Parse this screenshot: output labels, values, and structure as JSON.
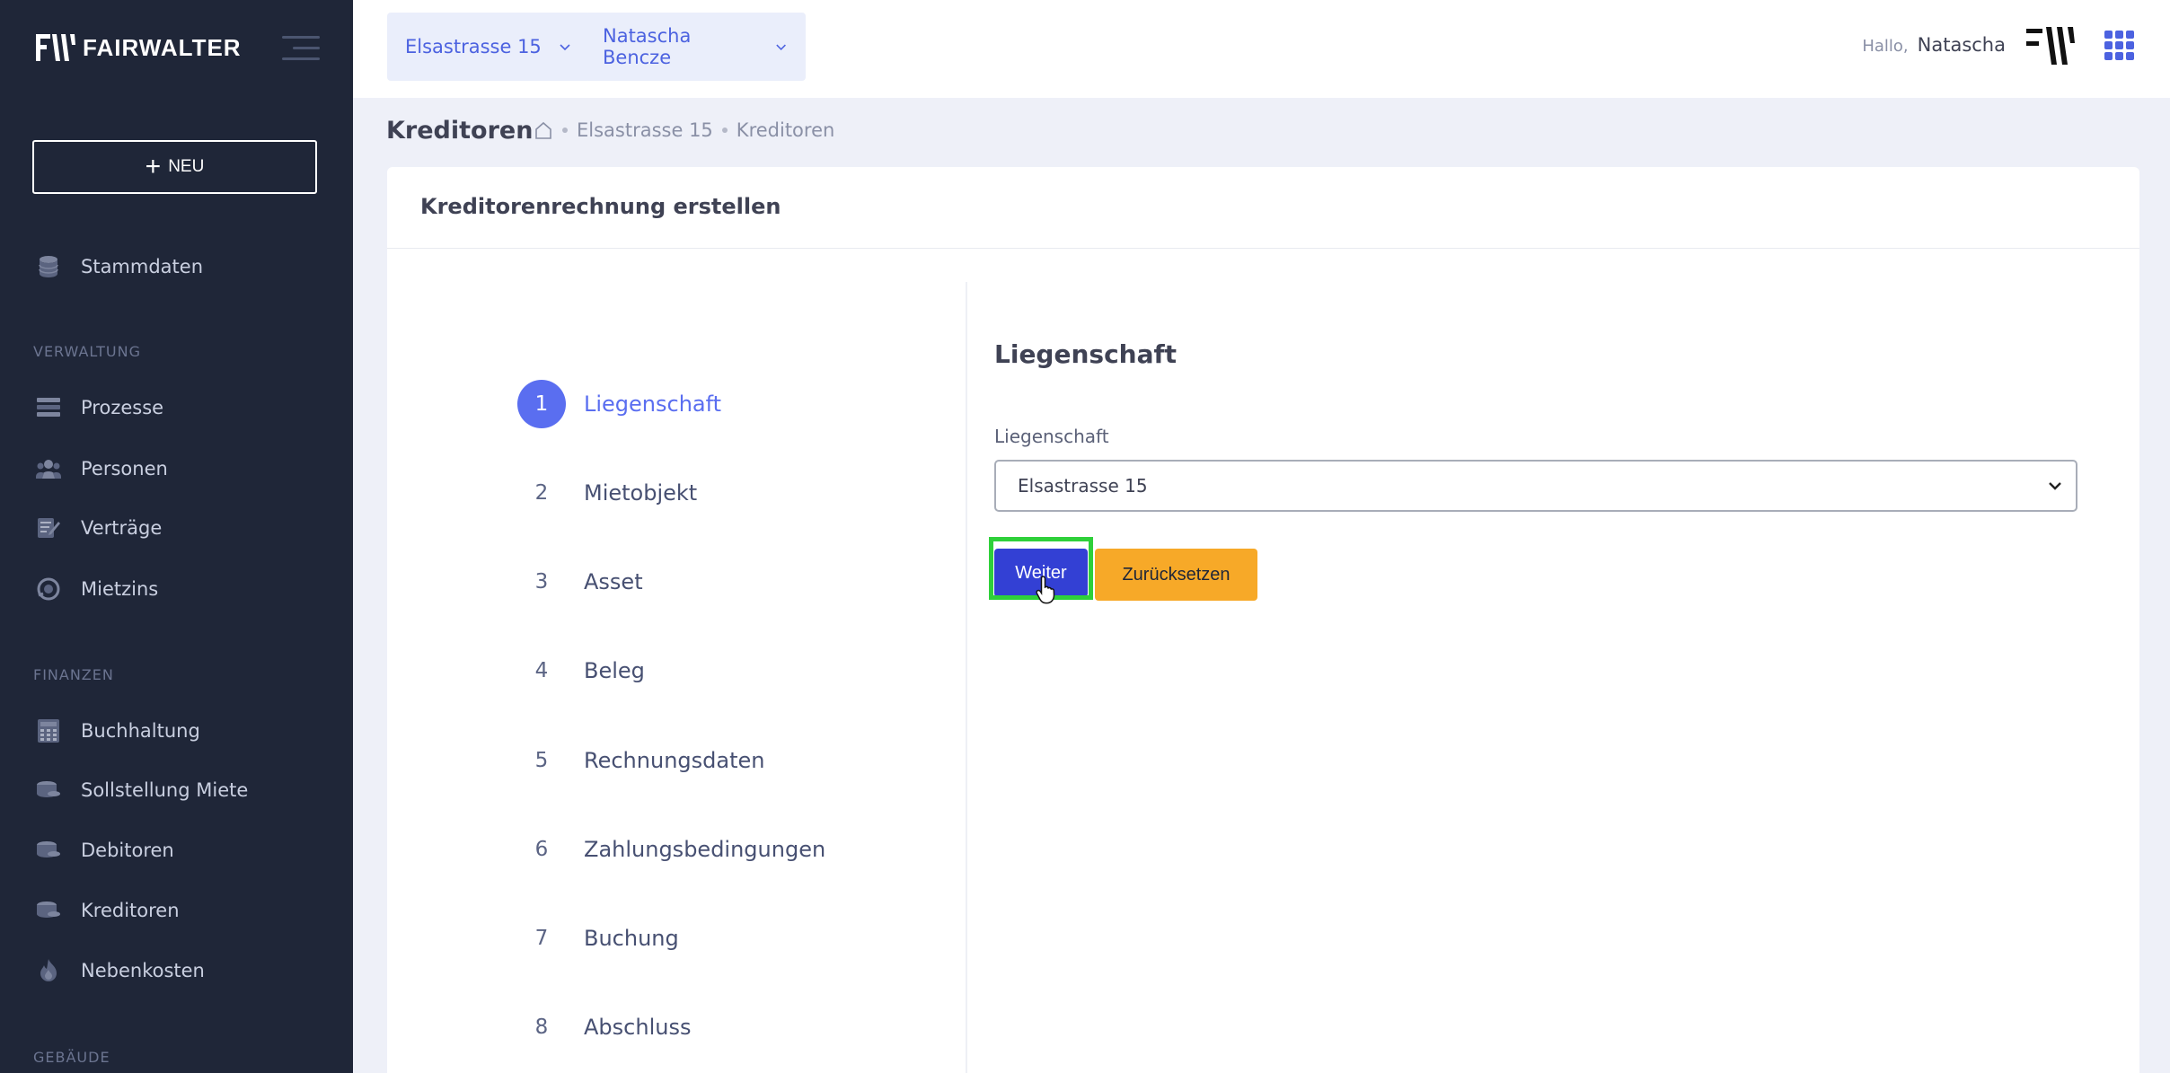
{
  "brand": {
    "name": "FAIRWALTER"
  },
  "sidebar": {
    "new_label": "NEU",
    "items": [
      {
        "label": "Stammdaten",
        "icon": "database-icon"
      },
      {
        "label": "Prozesse",
        "icon": "process-icon"
      },
      {
        "label": "Personen",
        "icon": "people-icon"
      },
      {
        "label": "Verträge",
        "icon": "contract-icon"
      },
      {
        "label": "Mietzins",
        "icon": "coin-icon"
      },
      {
        "label": "Buchhaltung",
        "icon": "calculator-icon"
      },
      {
        "label": "Sollstellung Miete",
        "icon": "coins-icon"
      },
      {
        "label": "Debitoren",
        "icon": "coins-icon"
      },
      {
        "label": "Kreditoren",
        "icon": "coins-icon"
      },
      {
        "label": "Nebenkosten",
        "icon": "flame-icon"
      }
    ],
    "sections": {
      "verwaltung": "VERWALTUNG",
      "finanzen": "FINANZEN",
      "gebaeude": "GEBÄUDE"
    }
  },
  "topbar": {
    "property_select": "Elsastrasse 15",
    "person_select": "Natascha Bencze",
    "hello": "Hallo,",
    "user_name": "Natascha"
  },
  "subheader": {
    "title": "Kreditoren",
    "breadcrumb": [
      "Elsastrasse 15",
      "Kreditoren"
    ]
  },
  "card": {
    "title": "Kreditorenrechnung erstellen",
    "steps": [
      {
        "num": "1",
        "label": "Liegenschaft"
      },
      {
        "num": "2",
        "label": "Mietobjekt"
      },
      {
        "num": "3",
        "label": "Asset"
      },
      {
        "num": "4",
        "label": "Beleg"
      },
      {
        "num": "5",
        "label": "Rechnungsdaten"
      },
      {
        "num": "6",
        "label": "Zahlungsbedingungen"
      },
      {
        "num": "7",
        "label": "Buchung"
      },
      {
        "num": "8",
        "label": "Abschluss"
      }
    ],
    "active_step": "1"
  },
  "form": {
    "heading": "Liegenschaft",
    "field_label": "Liegenschaft",
    "selected_value": "Elsastrasse 15",
    "next_label": "Weiter",
    "reset_label": "Zurücksetzen"
  },
  "colors": {
    "sidebar_bg": "#1f2638",
    "accent": "#5a6ef0",
    "primary_button": "#3340d4",
    "warning_button": "#f7a928",
    "focus_outline": "#2ed03a"
  }
}
